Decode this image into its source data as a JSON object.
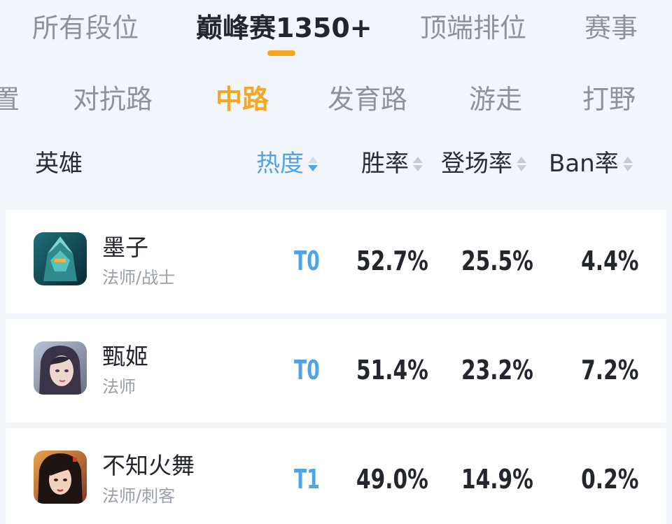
{
  "top_tabs": [
    {
      "label": "所有段位",
      "active": false
    },
    {
      "label": "巅峰赛1350+",
      "active": true
    },
    {
      "label": "顶端排位",
      "active": false
    },
    {
      "label": "赛事",
      "active": false
    }
  ],
  "lane_tabs": [
    {
      "label": "置",
      "active": false
    },
    {
      "label": "对抗路",
      "active": false
    },
    {
      "label": "中路",
      "active": true
    },
    {
      "label": "发育路",
      "active": false
    },
    {
      "label": "游走",
      "active": false
    },
    {
      "label": "打野",
      "active": false
    }
  ],
  "columns": {
    "hero": "英雄",
    "heat": "热度",
    "win_rate": "胜率",
    "pick_rate": "登场率",
    "ban_rate": "Ban率"
  },
  "heroes": [
    {
      "name": "墨子",
      "role": "法师/战士",
      "tier": "T0",
      "win_rate": "52.7%",
      "pick_rate": "25.5%",
      "ban_rate": "4.4%",
      "avatar_icon": "mozi-avatar"
    },
    {
      "name": "甄姬",
      "role": "法师",
      "tier": "T0",
      "win_rate": "51.4%",
      "pick_rate": "23.2%",
      "ban_rate": "7.2%",
      "avatar_icon": "zhenji-avatar"
    },
    {
      "name": "不知火舞",
      "role": "法师/刺客",
      "tier": "T1",
      "win_rate": "49.0%",
      "pick_rate": "14.9%",
      "ban_rate": "0.2%",
      "avatar_icon": "mai-avatar"
    }
  ],
  "colors": {
    "accent_orange": "#f5a623",
    "accent_blue": "#4fa3e8",
    "background": "#f2f5fa"
  }
}
